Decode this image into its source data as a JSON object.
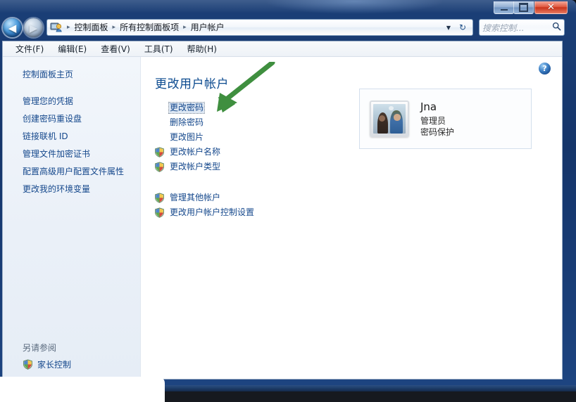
{
  "window": {
    "controls": {
      "minimize": "Minimize",
      "maximize": "Maximize",
      "close": "✕"
    }
  },
  "navbar": {
    "back_glyph": "◀",
    "forward_glyph": "▶",
    "address_icon": "user-accounts-icon",
    "breadcrumbs": [
      "控制面板",
      "所有控制面板项",
      "用户帐户"
    ],
    "separator": "▸",
    "dropdown_glyph": "▼",
    "refresh_glyph": "↻",
    "search": {
      "placeholder": "搜索控制...",
      "icon": "search-icon"
    }
  },
  "menubar": {
    "items": [
      "文件(F)",
      "编辑(E)",
      "查看(V)",
      "工具(T)",
      "帮助(H)"
    ]
  },
  "sidebar": {
    "home": "控制面板主页",
    "links": [
      "管理您的凭据",
      "创建密码重设盘",
      "链接联机 ID",
      "管理文件加密证书",
      "配置高级用户配置文件属性",
      "更改我的环境变量"
    ],
    "see_also": {
      "title": "另请参阅",
      "links": [
        {
          "label": "家长控制",
          "icon": "uac-shield-icon"
        }
      ]
    }
  },
  "main": {
    "help_button": "?",
    "title": "更改用户帐户",
    "primary_links": [
      {
        "label": "更改密码",
        "shield": false,
        "focused": true
      },
      {
        "label": "删除密码",
        "shield": false,
        "focused": false
      },
      {
        "label": "更改图片",
        "shield": false,
        "focused": false
      },
      {
        "label": "更改帐户名称",
        "shield": true,
        "focused": false
      },
      {
        "label": "更改帐户类型",
        "shield": true,
        "focused": false
      }
    ],
    "secondary_links": [
      {
        "label": "管理其他帐户",
        "shield": true,
        "focused": false
      },
      {
        "label": "更改用户帐户控制设置",
        "shield": true,
        "focused": false
      }
    ],
    "user_card": {
      "avatar": "user-photo-avatar",
      "name": "Jna",
      "role": "管理员",
      "password_status": "密码保护"
    }
  },
  "annotation": {
    "arrow": "green-arrow-pointing-to-change-password",
    "color": "#3f8f3f"
  },
  "colors": {
    "link": "#15488c",
    "title": "#0b4a8f",
    "titlebar": "#173a72",
    "close_button": "#c8341c",
    "sidebar_bg": "#eaf0f8"
  }
}
